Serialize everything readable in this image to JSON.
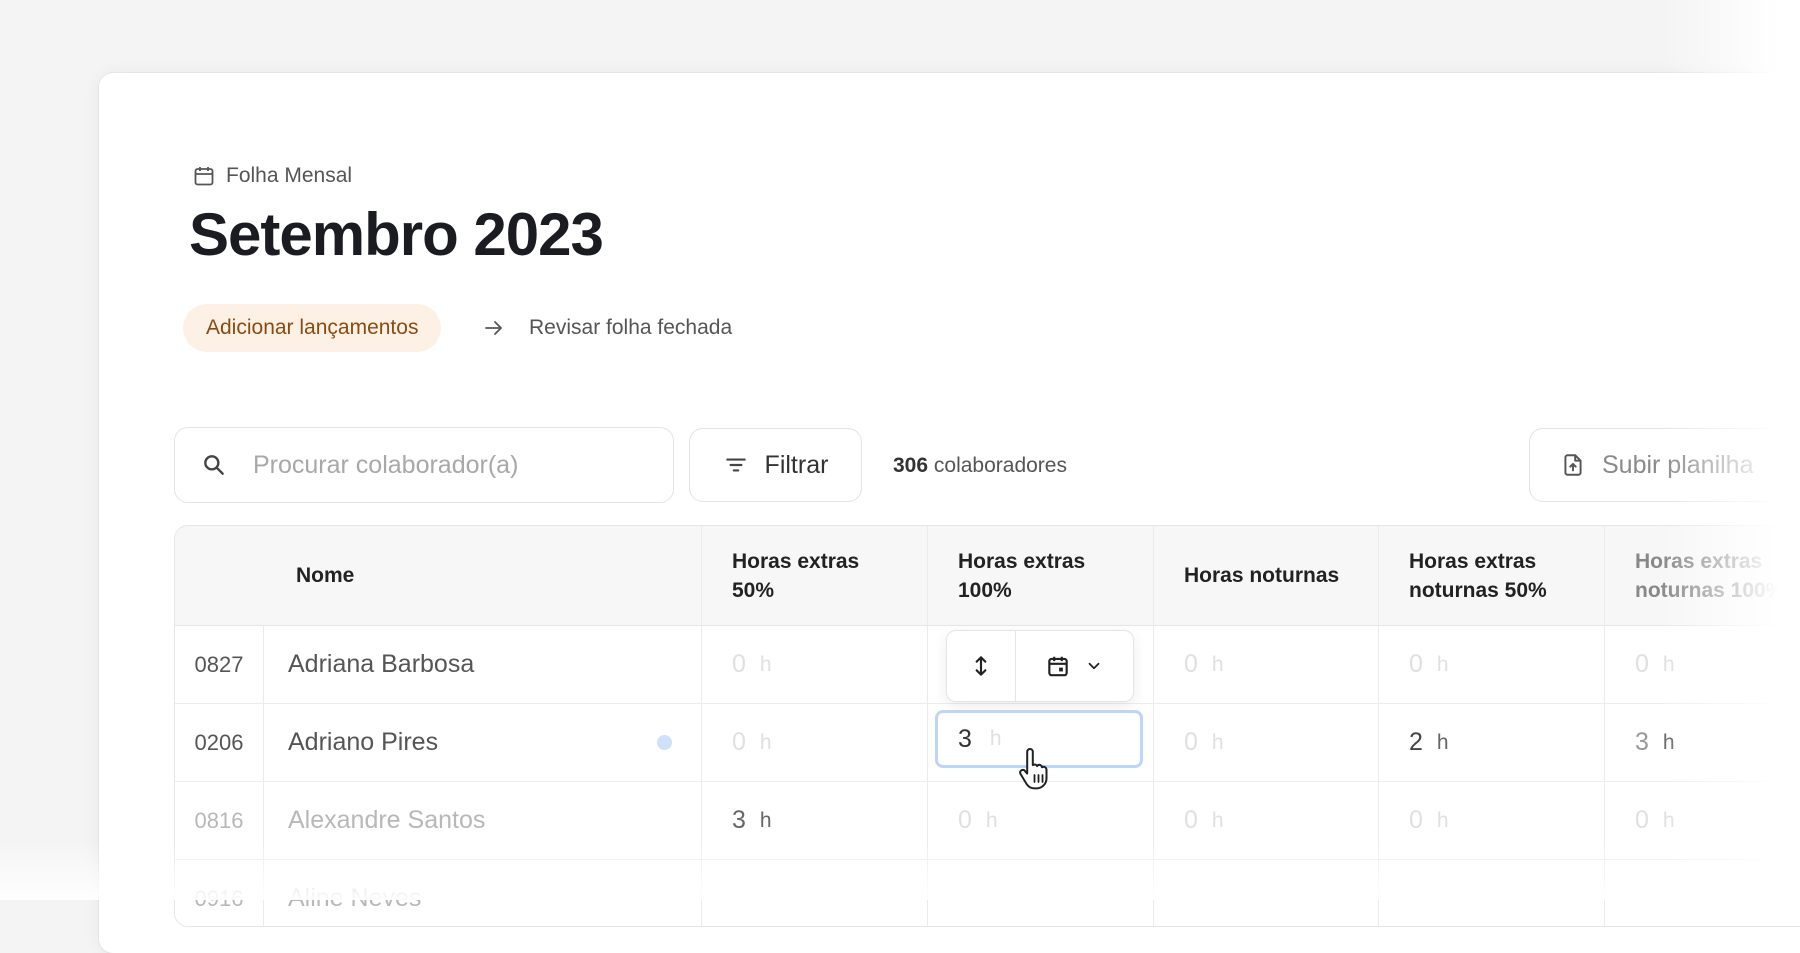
{
  "breadcrumb": {
    "icon": "calendar-icon",
    "label": "Folha Mensal"
  },
  "page": {
    "title": "Setembro 2023"
  },
  "steps": {
    "active": "Adicionar lançamentos",
    "next": "Revisar folha fechada"
  },
  "toolbar": {
    "search_placeholder": "Procurar colaborador(a)",
    "filter_label": "Filtrar",
    "count_number": "306",
    "count_label": "colaboradores",
    "upload_label": "Subir planilha"
  },
  "table": {
    "columns": [
      {
        "line1": "Nome",
        "line2": ""
      },
      {
        "line1": "Horas extras",
        "line2": "50%"
      },
      {
        "line1": "Horas extras",
        "line2": "100%"
      },
      {
        "line1": "Horas noturnas",
        "line2": ""
      },
      {
        "line1": "Horas extras",
        "line2": "noturnas 50%"
      },
      {
        "line1": "Horas extras",
        "line2": "noturnas 100%"
      }
    ],
    "unit": "h",
    "rows": [
      {
        "id": "0827",
        "name": "Adriana Barbosa",
        "values": [
          "0",
          "",
          "0",
          "0",
          "0"
        ]
      },
      {
        "id": "0206",
        "name": "Adriano Pires",
        "values": [
          "0",
          "3",
          "0",
          "2",
          "3"
        ]
      },
      {
        "id": "0816",
        "name": "Alexandre Santos",
        "values": [
          "3",
          "0",
          "0",
          "0",
          "0"
        ]
      },
      {
        "id": "0916",
        "name": "Aline Neves",
        "values": [
          "",
          "",
          "",
          "",
          ""
        ]
      }
    ]
  },
  "editing": {
    "value": "3",
    "unit": "h"
  },
  "accent_colors": {
    "step_bg": "#fdf1e6",
    "step_text": "#8a4b10",
    "focus_border": "#bcd5f8"
  }
}
